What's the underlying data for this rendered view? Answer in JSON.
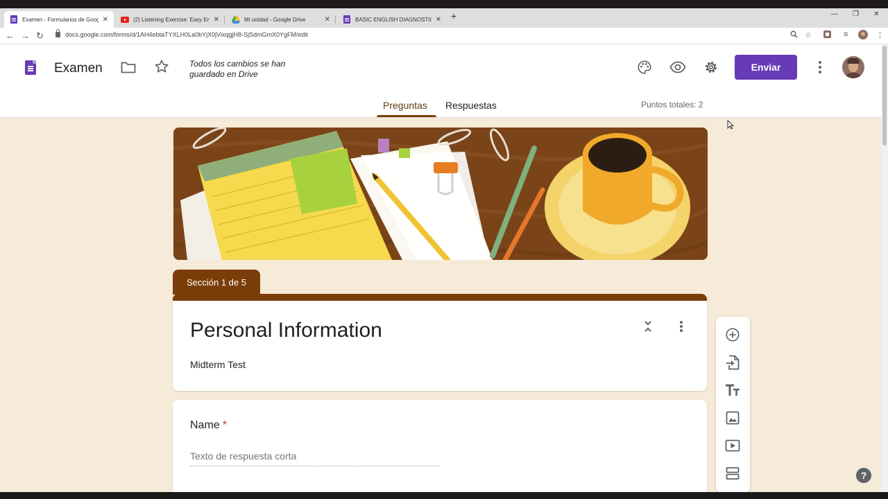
{
  "browser": {
    "tabs": [
      {
        "title": "Examen - Formularios de Google",
        "icon": "google-forms-icon",
        "active": true
      },
      {
        "title": "(2) Listening Exercise: Easy English",
        "icon": "youtube-icon",
        "active": false
      },
      {
        "title": "Mi unidad - Google Drive",
        "icon": "google-drive-icon",
        "active": false
      },
      {
        "title": "BASIC ENGLISH DIAGNOSTIC TEST",
        "icon": "google-forms-icon",
        "active": false
      }
    ],
    "new_tab": "+",
    "url": "docs.google.com/forms/d/1AH4ebtaTYXLH0La0bYjX0jVixqgjH8-SjSdmGmX0YgFM/edit"
  },
  "header": {
    "doc_title": "Examen",
    "save_status": "Todos los cambios se han guardado en Drive",
    "send_label": "Enviar"
  },
  "tabs": [
    {
      "label": "Preguntas",
      "active": true
    },
    {
      "label": "Respuestas",
      "active": false
    }
  ],
  "points_total": "Puntos totales: 2",
  "section": {
    "label": "Sección 1 de 5",
    "title": "Personal Information",
    "description": "Midterm Test"
  },
  "question": {
    "title": "Name",
    "required_mark": "*",
    "answer_placeholder": "Texto de respuesta corta"
  },
  "help_label": "?",
  "colors": {
    "theme": "#7a3d0a",
    "background": "#f6ead8",
    "send_button": "#673ab7",
    "required": "#d93025"
  }
}
